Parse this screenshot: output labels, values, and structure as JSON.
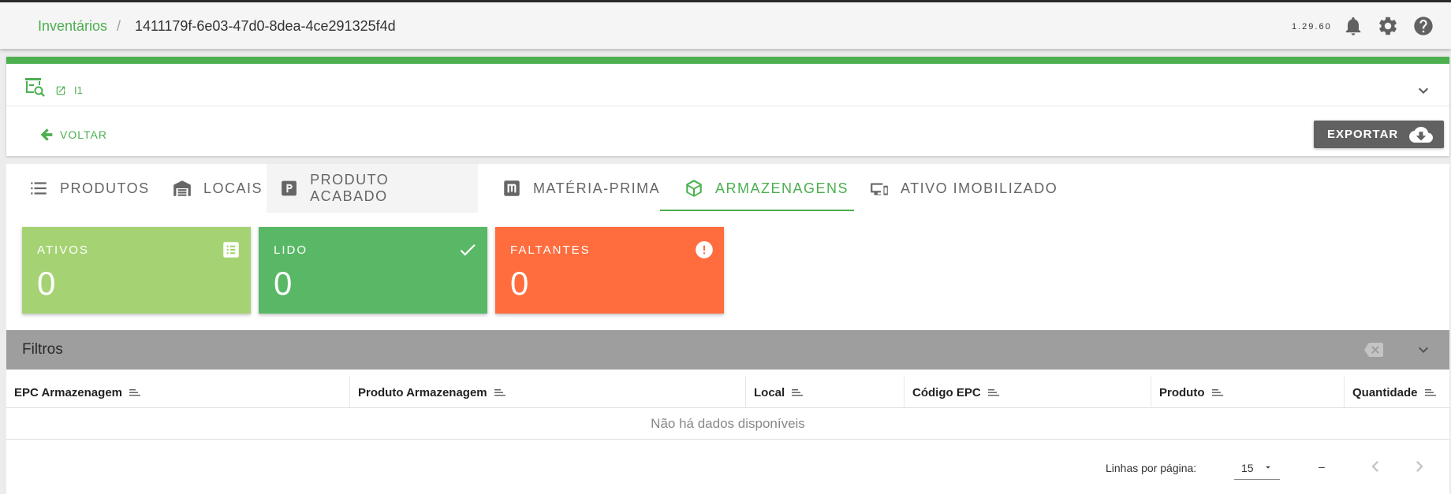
{
  "header": {
    "breadcrumb_link": "Inventários",
    "breadcrumb_separator": "/",
    "breadcrumb_current": "1411179f-6e03-47d0-8dea-4ce291325f4d",
    "version": "1.29.60",
    "icons": [
      "bell-icon",
      "gear-icon",
      "help-icon"
    ]
  },
  "inventory": {
    "name": "I1",
    "back_label": "VOLTAR",
    "export_label": "EXPORTAR"
  },
  "tabs": [
    {
      "label": "PRODUTOS",
      "icon": "list-icon"
    },
    {
      "label": "LOCAIS",
      "icon": "warehouse-icon"
    },
    {
      "label": "PRODUTO ACABADO",
      "icon": "letter-p-icon"
    },
    {
      "label": "MATÉRIA-PRIMA",
      "icon": "letter-m-icon"
    },
    {
      "label": "ARMAZENAGENS",
      "icon": "package-icon",
      "active": true
    },
    {
      "label": "ATIVO IMOBILIZADO",
      "icon": "devices-icon"
    }
  ],
  "stats": [
    {
      "title": "ATIVOS",
      "value": "0",
      "color": "#a5d374",
      "icon": "list-box-icon"
    },
    {
      "title": "LIDO",
      "value": "0",
      "color": "#58b866",
      "icon": "check-icon"
    },
    {
      "title": "FALTANTES",
      "value": "0",
      "color": "#ff6d3f",
      "icon": "alert-circle-icon"
    }
  ],
  "filters": {
    "title": "Filtros"
  },
  "table": {
    "columns": [
      "EPC Armazenagem",
      "Produto Armazenagem",
      "Local",
      "Código EPC",
      "Produto",
      "Quantidade"
    ],
    "empty_message": "Não há dados disponíveis"
  },
  "pagination": {
    "rows_per_page_label": "Linhas por página:",
    "rows_per_page_value": "15",
    "page_info": "–"
  },
  "colors": {
    "accent": "#4caf50",
    "export_button": "#616161",
    "filters_bar": "#9e9e9e"
  }
}
